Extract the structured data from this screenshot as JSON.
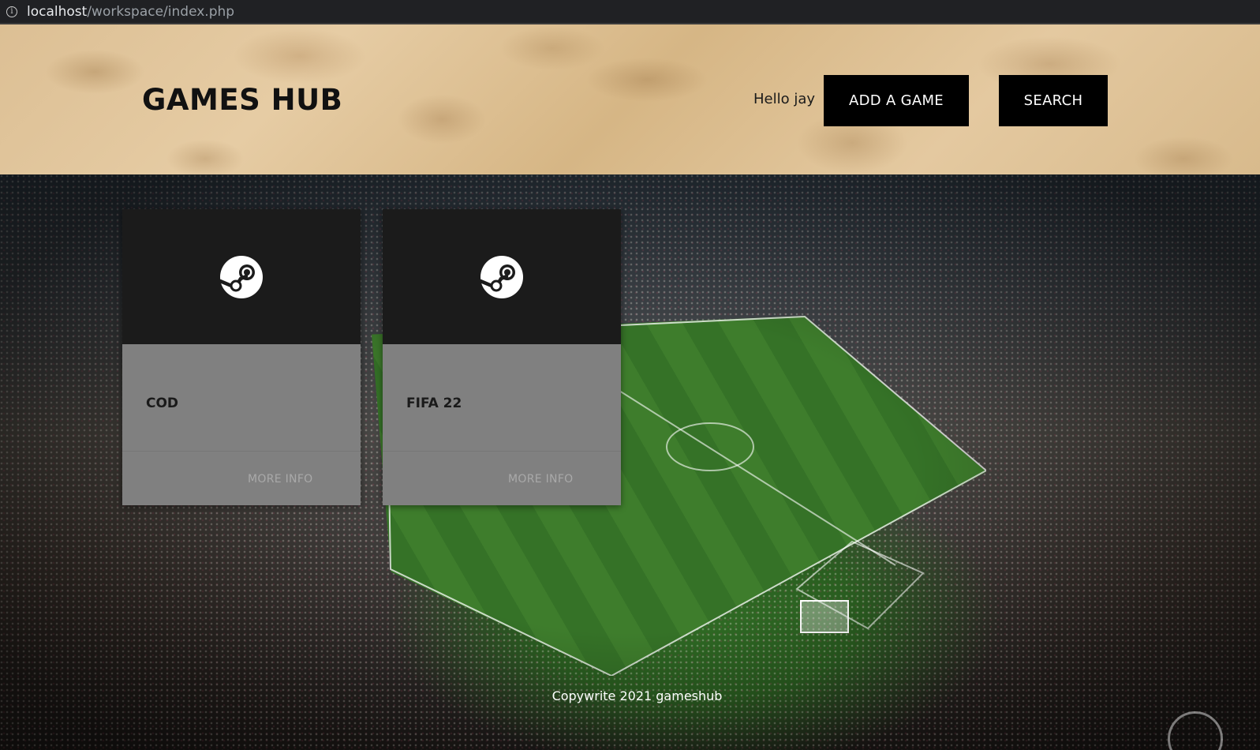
{
  "browser": {
    "url_host": "localhost",
    "url_path": "/workspace/index.php"
  },
  "header": {
    "title": "GAMES HUB",
    "greeting": "Hello jay",
    "add_game_label": "ADD A GAME",
    "search_label": "SEARCH"
  },
  "cards": [
    {
      "title": "COD",
      "icon": "steam-icon",
      "more_info_label": "MORE INFO"
    },
    {
      "title": "FIFA 22",
      "icon": "steam-icon",
      "more_info_label": "MORE INFO"
    }
  ],
  "footer": {
    "text": "Copywrite 2021 gameshub"
  },
  "colors": {
    "button_bg": "#000000",
    "card_bg": "#808080",
    "card_top_bg": "#1b1b1b"
  }
}
